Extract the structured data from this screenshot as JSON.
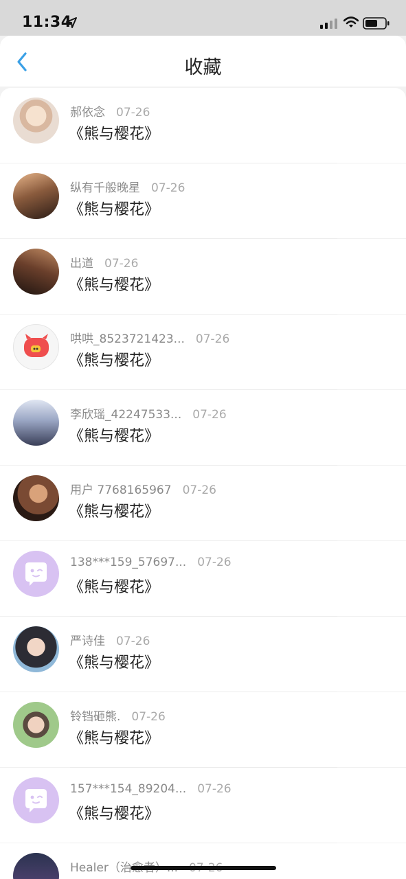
{
  "status_bar": {
    "time": "11:34"
  },
  "nav": {
    "title": "收藏"
  },
  "items": [
    {
      "user": "郝依念",
      "date": "07-26",
      "title": "《熊与樱花》"
    },
    {
      "user": "纵有千般晚星",
      "date": "07-26",
      "title": "《熊与樱花》"
    },
    {
      "user": "出道",
      "date": "07-26",
      "title": "《熊与樱花》"
    },
    {
      "user": "哄哄_8523721423...",
      "date": "07-26",
      "title": "《熊与樱花》"
    },
    {
      "user": "李欣瑶_42247533...",
      "date": "07-26",
      "title": "《熊与樱花》"
    },
    {
      "user": "用户 7768165967",
      "date": "07-26",
      "title": "《熊与樱花》"
    },
    {
      "user": "138***159_57697...",
      "date": "07-26",
      "title": "《熊与樱花》"
    },
    {
      "user": "严诗佳",
      "date": "07-26",
      "title": "《熊与樱花》"
    },
    {
      "user": "铃铛砸熊.",
      "date": "07-26",
      "title": "《熊与樱花》"
    },
    {
      "user": "157***154_89204...",
      "date": "07-26",
      "title": "《熊与樱花》"
    },
    {
      "user": "Healer（治愈者）...",
      "date": "07-26",
      "title": ""
    }
  ],
  "colors": {
    "accent": "#3aa0e6",
    "default_avatar": "#d8c2f2"
  },
  "icons": {
    "back": "chevron-left-icon",
    "location": "location-arrow-icon",
    "signal": "cellular-signal-icon",
    "wifi": "wifi-icon",
    "battery": "battery-icon"
  }
}
